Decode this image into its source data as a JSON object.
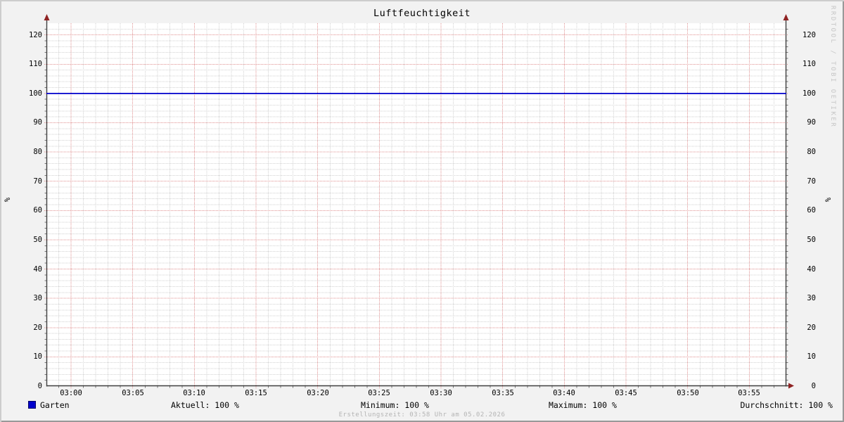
{
  "title": "Luftfeuchtigkeit",
  "watermark": "RRDTOOL / TOBI OETIKER",
  "footer": "Erstellungszeit: 03:58 Uhr am 05.02.2026",
  "chart_data": {
    "type": "line",
    "title": "Luftfeuchtigkeit",
    "ylabel": "%",
    "ylabel_right": "%",
    "ylim": [
      0,
      124
    ],
    "y_ticks": [
      0,
      10,
      20,
      30,
      40,
      50,
      60,
      70,
      80,
      90,
      100,
      110,
      120
    ],
    "y_minor_step": 2,
    "x_start": "02:58",
    "x_end": "03:58",
    "x_minor_step_min": 1,
    "x_major_step_min": 5,
    "x_ticks": [
      "03:00",
      "03:05",
      "03:10",
      "03:15",
      "03:20",
      "03:25",
      "03:30",
      "03:35",
      "03:40",
      "03:45",
      "03:50",
      "03:55"
    ],
    "grid": true,
    "legend_position": "bottom",
    "series": [
      {
        "name": "Garten",
        "color": "#0000CC",
        "points": [
          {
            "t": "02:58",
            "v": 100
          },
          {
            "t": "03:58",
            "v": 100
          }
        ]
      }
    ]
  },
  "legend": {
    "series_label": "Garten",
    "series_color": "#0000CC",
    "stats": [
      "Aktuell: 100 %",
      "Minimum: 100 %",
      "Maximum: 100 %",
      "Durchschnitt: 100 %"
    ]
  },
  "colors": {
    "background": "#F2F2F2",
    "canvas": "#FFFFFF",
    "grid_minor": "#D2D2D2",
    "grid_major": "#E09090",
    "axis": "#404040",
    "tick_minor": "#777777",
    "arrow": "#8F2323",
    "line": "#0000CC"
  }
}
